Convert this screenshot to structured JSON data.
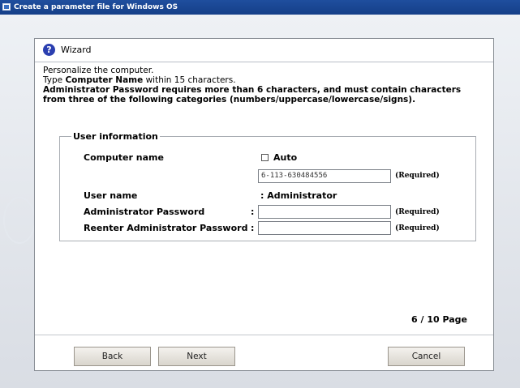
{
  "window": {
    "title": "Create a parameter file for Windows OS"
  },
  "dialog": {
    "title": "Wizard",
    "intro": {
      "line1": "Personalize the computer.",
      "line2_prefix": "Type ",
      "line2_bold": "Computer Name",
      "line2_suffix": " within 15 characters.",
      "line3": "Administrator Password requires more than 6 characters, and must contain characters",
      "line4": "from three of the following categories (numbers/uppercase/lowercase/signs)."
    },
    "group": {
      "legend": "User information",
      "computer_name": {
        "label": "Computer name",
        "colon": ":",
        "auto_label": "Auto",
        "auto_checked": false,
        "value": "6-113-630484556",
        "required": "(Required)"
      },
      "user_name": {
        "label": "User name",
        "value": ": Administrator"
      },
      "admin_password": {
        "label": "Administrator Password",
        "colon": ":",
        "value": "",
        "required": "(Required)"
      },
      "reenter_password": {
        "label": "Reenter Administrator Password",
        "colon": ":",
        "value": "",
        "required": "(Required)"
      }
    },
    "page_indicator": "6 / 10 Page",
    "buttons": {
      "back": "Back",
      "next": "Next",
      "cancel": "Cancel"
    }
  }
}
